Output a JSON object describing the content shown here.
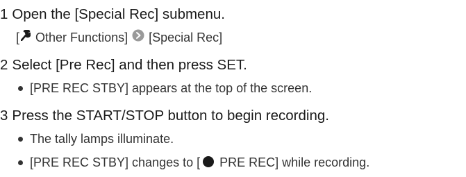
{
  "steps": [
    {
      "number": "1",
      "title": "Open the [Special Rec] submenu.",
      "menu_path": {
        "open_bracket": "[",
        "icon": "wrench-icon",
        "menu": "Other Functions]",
        "arrow_icon": "arrow-right-circle-icon",
        "submenu": "[Special Rec]"
      }
    },
    {
      "number": "2",
      "title": "Select [Pre Rec] and then press SET.",
      "bullets": [
        "[PRE REC STBY] appears at the top of the screen."
      ]
    },
    {
      "number": "3",
      "title": "Press the START/STOP button to begin recording.",
      "bullets": [
        "The tally lamps illuminate."
      ],
      "last_bullet": {
        "before": "[PRE REC STBY] changes to [",
        "icon": "record-dot-icon",
        "after": "PRE REC] while recording."
      }
    }
  ]
}
